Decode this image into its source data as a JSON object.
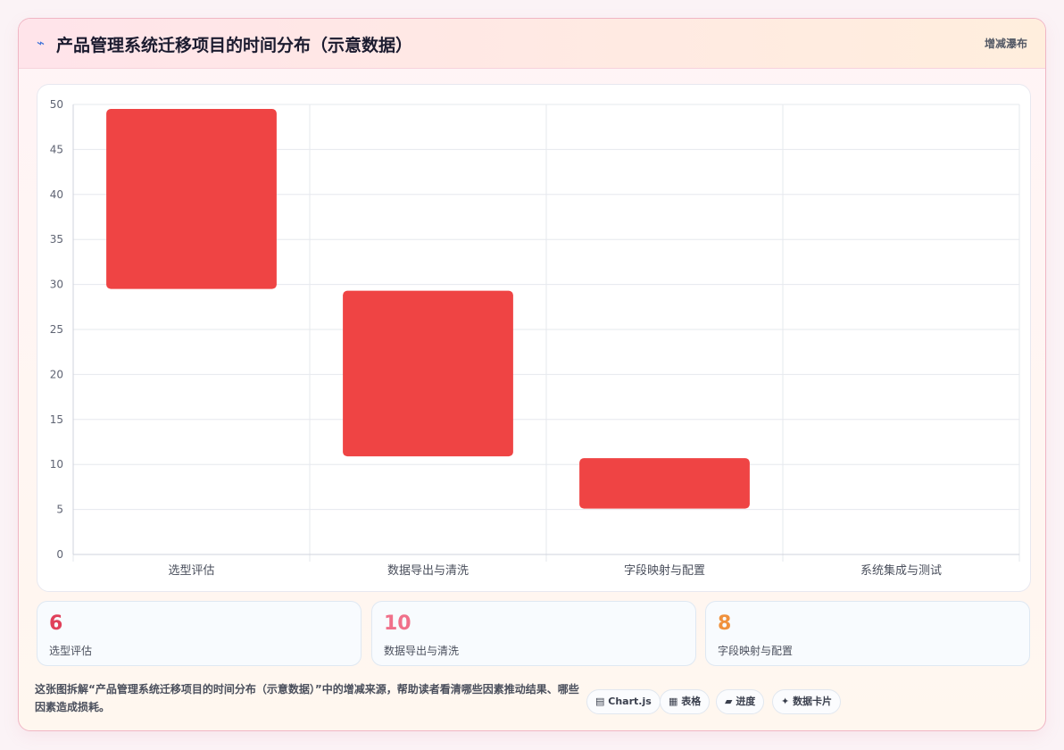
{
  "header": {
    "icon": "lightning-icon",
    "title": "产品管理系统迁移项目的时间分布（示意数据）",
    "tag": "增减瀑布"
  },
  "chart_data": {
    "type": "bar",
    "subtype": "waterfall",
    "categories": [
      "选型评估",
      "数据导出与清洗",
      "字段映射与配置",
      "系统集成与测试"
    ],
    "series": [
      {
        "ranges": [
          [
            29.5,
            49.5
          ],
          [
            10.9,
            29.3
          ],
          [
            5.1,
            10.7
          ],
          [
            0,
            0
          ]
        ],
        "color": "#ef4444"
      }
    ],
    "ylim": [
      0,
      50
    ],
    "yticks": [
      0,
      5,
      10,
      15,
      20,
      25,
      30,
      35,
      40,
      45,
      50
    ],
    "grid": true
  },
  "stats": [
    {
      "value": "6",
      "label": "选型评估",
      "color": "#e0405a"
    },
    {
      "value": "10",
      "label": "数据导出与清洗",
      "color": "#f0708a"
    },
    {
      "value": "8",
      "label": "字段映射与配置",
      "color": "#f0913c"
    }
  ],
  "description": "这张图拆解“产品管理系统迁移项目的时间分布（示意数据）”中的增减来源，帮助读者看清哪些因素推动结果、哪些因素造成损耗。",
  "chips": [
    {
      "icon": "▤",
      "label": "Chart.js"
    },
    {
      "icon": "▦",
      "label": "表格"
    },
    {
      "icon": "▰",
      "label": "进度"
    },
    {
      "icon": "✦",
      "label": "数据卡片"
    }
  ]
}
